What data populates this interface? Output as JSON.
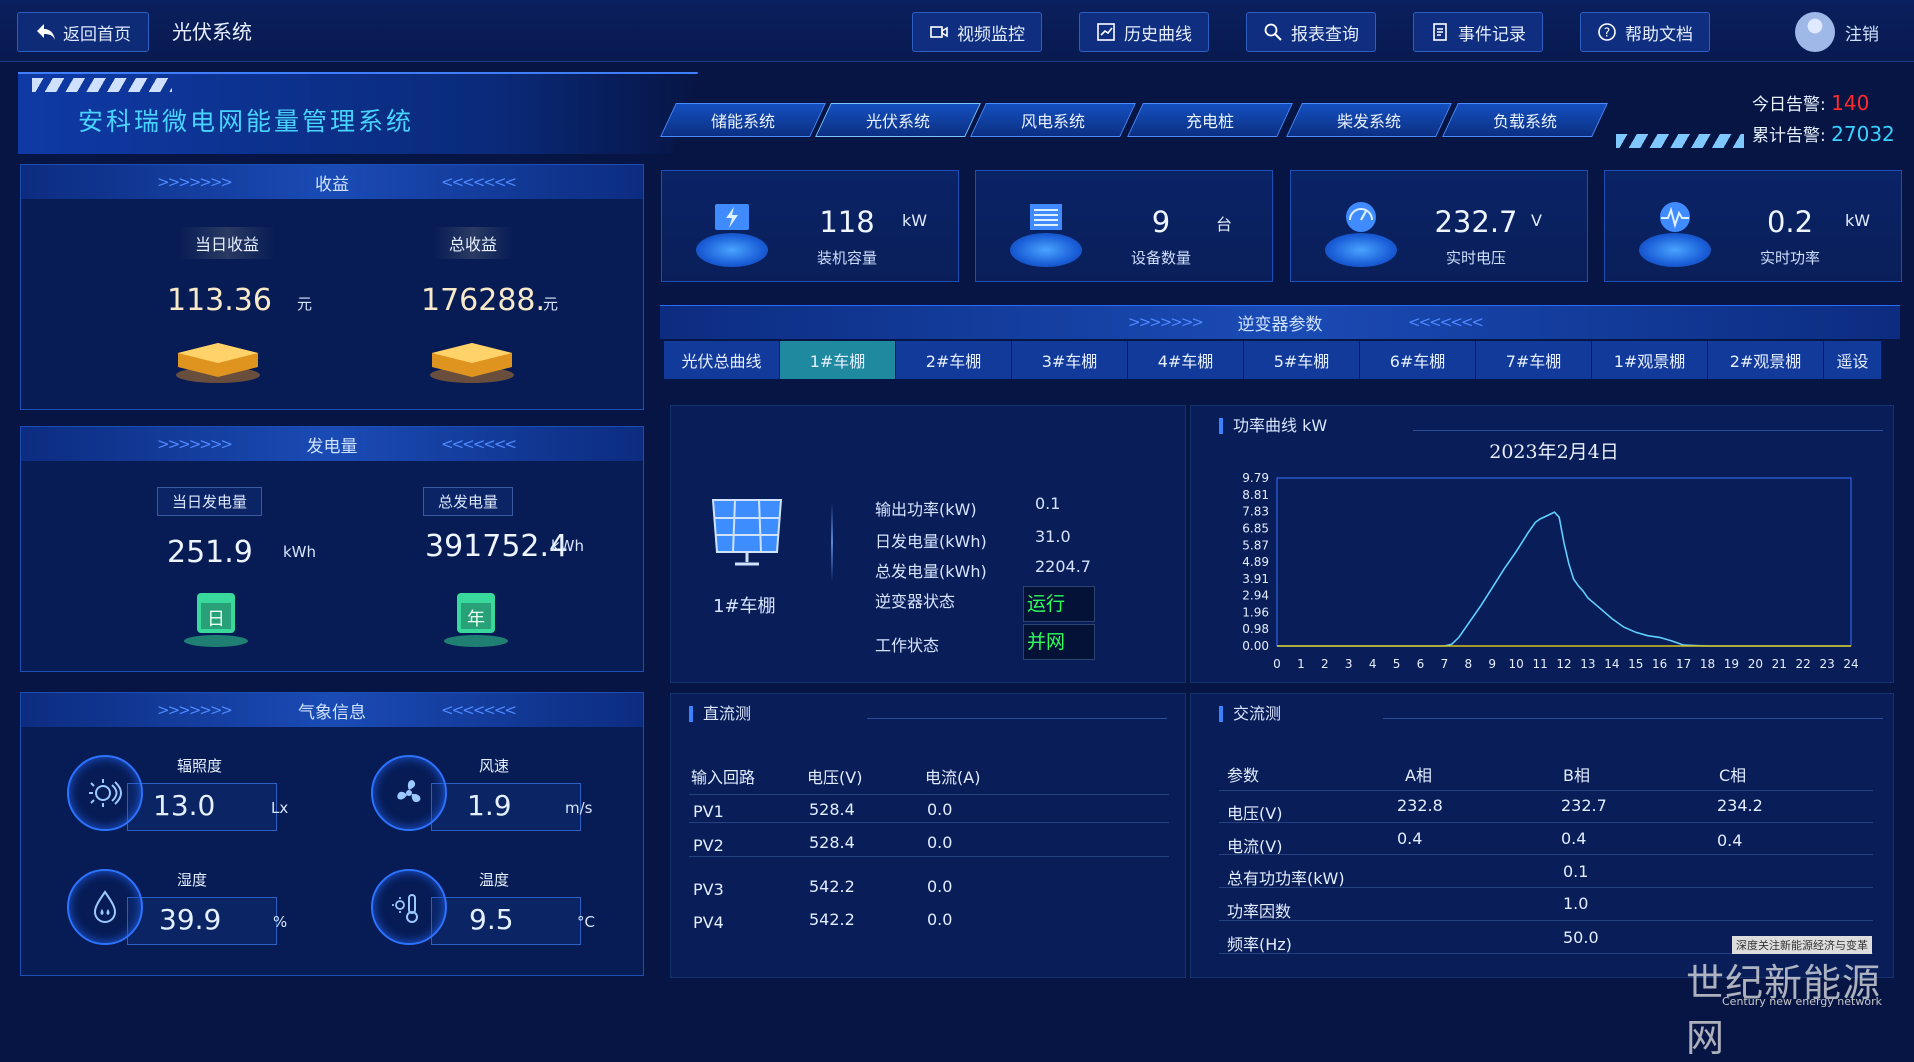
{
  "topbar": {
    "back_label": "返回首页",
    "system_name": "光伏系统",
    "nav": [
      {
        "label": "视频监控",
        "icon": "video-icon"
      },
      {
        "label": "历史曲线",
        "icon": "chart-icon"
      },
      {
        "label": "报表查询",
        "icon": "search-icon"
      },
      {
        "label": "事件记录",
        "icon": "document-icon"
      },
      {
        "label": "帮助文档",
        "icon": "help-icon"
      }
    ],
    "logout_label": "注销"
  },
  "header": {
    "title": "安科瑞微电网能量管理系统",
    "system_tabs": [
      "储能系统",
      "光伏系统",
      "风电系统",
      "充电桩",
      "柴发系统",
      "负载系统"
    ],
    "alarm_today_label": "今日告警:",
    "alarm_today_value": "140",
    "alarm_total_label": "累计告警:",
    "alarm_total_value": "27032",
    "alarm_today_color": "#ff2b2b",
    "alarm_total_color": "#39d2ff"
  },
  "revenue": {
    "title": "收益",
    "today_label": "当日收益",
    "today_value": "113.36",
    "today_unit": "元",
    "total_label": "总收益",
    "total_value": "176288.",
    "total_unit": "元"
  },
  "generation": {
    "title": "发电量",
    "today_label": "当日发电量",
    "today_value": "251.9",
    "today_unit": "kWh",
    "today_icon_text": "日",
    "total_label": "总发电量",
    "total_value": "391752.4",
    "total_unit": "kWh",
    "total_icon_text": "年"
  },
  "weather": {
    "title": "气象信息",
    "items": [
      {
        "name": "辐照度",
        "value": "13.0",
        "unit": "Lx",
        "icon": "sun-icon"
      },
      {
        "name": "风速",
        "value": "1.9",
        "unit": "m/s",
        "icon": "fan-icon"
      },
      {
        "name": "湿度",
        "value": "39.9",
        "unit": "%",
        "icon": "humidity-icon"
      },
      {
        "name": "温度",
        "value": "9.5",
        "unit": "°C",
        "icon": "thermometer-icon"
      }
    ]
  },
  "stats": [
    {
      "value": "118",
      "unit": "kW",
      "label": "装机容量",
      "icon": "battery-icon"
    },
    {
      "value": "9",
      "unit": "台",
      "label": "设备数量",
      "icon": "server-icon"
    },
    {
      "value": "232.7",
      "unit": "V",
      "label": "实时电压",
      "icon": "gauge-icon"
    },
    {
      "value": "0.2",
      "unit": "kW",
      "label": "实时功率",
      "icon": "pulse-icon"
    }
  ],
  "inverter": {
    "title": "逆变器参数",
    "tabs": [
      "光伏总曲线",
      "1#车棚",
      "2#车棚",
      "3#车棚",
      "4#车棚",
      "5#车棚",
      "6#车棚",
      "7#车棚",
      "1#观景棚",
      "2#观景棚",
      "遥设"
    ],
    "active_tab": "1#车棚",
    "device_name": "1#车棚",
    "params": [
      {
        "label": "输出功率(kW)",
        "value": "0.1"
      },
      {
        "label": "日发电量(kWh)",
        "value": "31.0"
      },
      {
        "label": "总发电量(kWh)",
        "value": "2204.7"
      }
    ],
    "status_label": "逆变器状态",
    "status_value": "运行",
    "work_label": "工作状态",
    "work_value": "并网"
  },
  "power_chart": {
    "panel_title": "功率曲线 kW",
    "date_title": "2023年2月4日"
  },
  "chart_data": {
    "type": "line",
    "title": "2023年2月4日",
    "ylabel": "kW",
    "xlabel": "",
    "ylim": [
      0,
      9.79
    ],
    "xlim": [
      0,
      24
    ],
    "y_ticks": [
      "9.79",
      "8.81",
      "7.83",
      "6.85",
      "5.87",
      "4.89",
      "3.91",
      "2.94",
      "1.96",
      "0.98",
      "0.00"
    ],
    "x_ticks": [
      "0",
      "1",
      "2",
      "3",
      "4",
      "5",
      "6",
      "7",
      "8",
      "9",
      "10",
      "11",
      "12",
      "13",
      "14",
      "15",
      "16",
      "17",
      "18",
      "19",
      "20",
      "21",
      "22",
      "23",
      "24"
    ],
    "series": [
      {
        "color": "#5fd0ff",
        "x": [
          0,
          7,
          7.3,
          7.6,
          8,
          8.5,
          9,
          9.5,
          10,
          10.5,
          10.8,
          11,
          11.3,
          11.6,
          11.8,
          12,
          12.2,
          12.4,
          12.6,
          12.8,
          13,
          13.5,
          14,
          14.5,
          15,
          15.5,
          16,
          16.5,
          17,
          18,
          24
        ],
        "y": [
          0,
          0,
          0.1,
          0.5,
          1.3,
          2.3,
          3.4,
          4.5,
          5.5,
          6.6,
          7.2,
          7.4,
          7.6,
          7.8,
          7.5,
          6.0,
          4.8,
          3.9,
          3.5,
          3.2,
          2.8,
          2.2,
          1.6,
          1.1,
          0.8,
          0.6,
          0.5,
          0.3,
          0.05,
          0,
          0
        ]
      },
      {
        "color": "#d9c21a",
        "x": [
          0,
          24
        ],
        "y": [
          0,
          0
        ]
      }
    ]
  },
  "dc": {
    "title": "直流测",
    "headers": [
      "输入回路",
      "电压(V)",
      "电流(A)"
    ],
    "rows": [
      [
        "PV1",
        "528.4",
        "0.0"
      ],
      [
        "PV2",
        "528.4",
        "0.0"
      ],
      [
        "PV3",
        "542.2",
        "0.0"
      ],
      [
        "PV4",
        "542.2",
        "0.0"
      ]
    ]
  },
  "ac": {
    "title": "交流测",
    "headers": [
      "参数",
      "A相",
      "B相",
      "C相"
    ],
    "rows": [
      [
        "电压(V)",
        "232.8",
        "232.7",
        "234.2"
      ],
      [
        "电流(V)",
        "0.4",
        "0.4",
        "0.4"
      ],
      [
        "总有功功率(kW)",
        "",
        "0.1",
        ""
      ],
      [
        "功率因数",
        "",
        "1.0",
        ""
      ],
      [
        "频率(Hz)",
        "",
        "50.0",
        ""
      ]
    ]
  },
  "watermark": {
    "small": "深度关注新能源经济与变革",
    "main": "世纪新能源网",
    "en": "Century new energy network"
  }
}
